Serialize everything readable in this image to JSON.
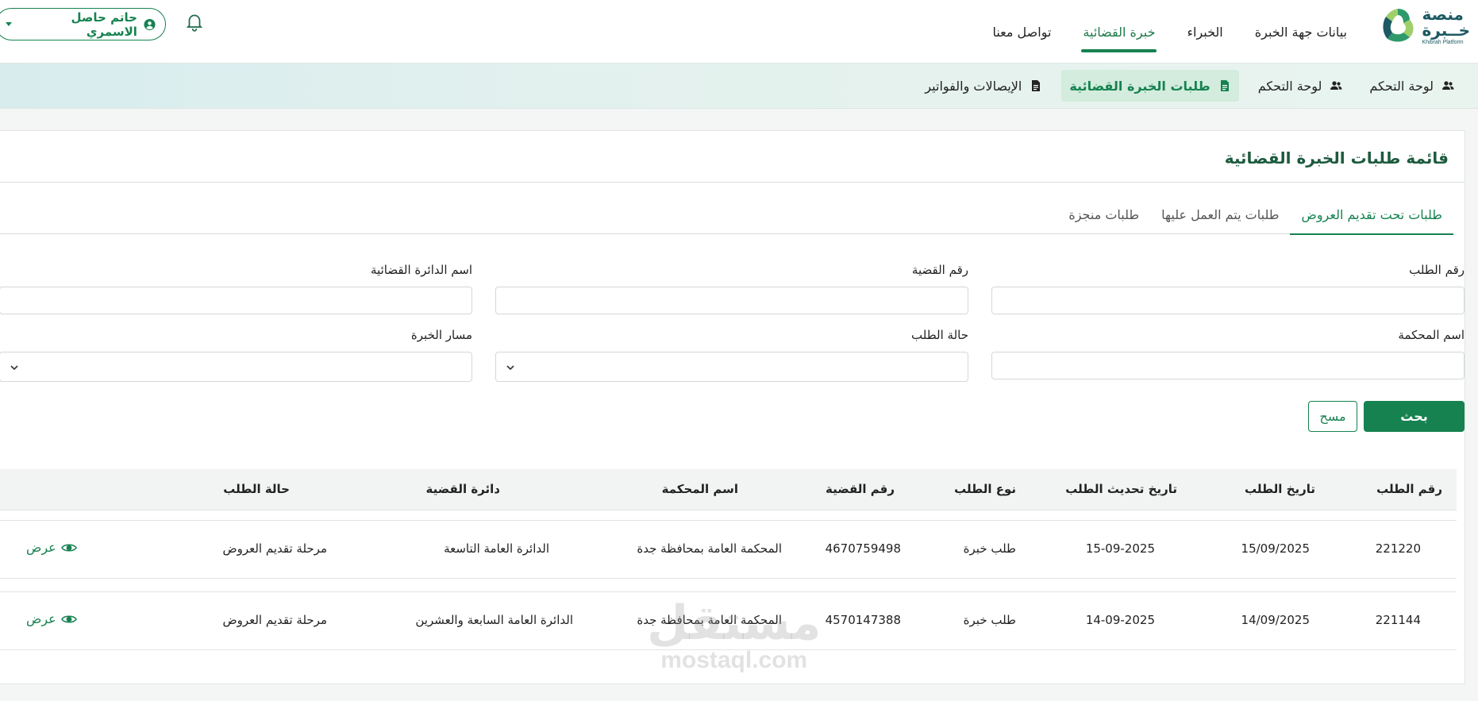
{
  "logo": {
    "line1": "منصة",
    "line2": "خــبرة",
    "en": "Khibrah Platform"
  },
  "topnav": [
    {
      "label": "بيانات جهة الخبرة",
      "active": false
    },
    {
      "label": "الخبراء",
      "active": false
    },
    {
      "label": "خبرة القضائية",
      "active": true
    },
    {
      "label": "تواصل معنا",
      "active": false
    }
  ],
  "user": {
    "name": "حاتم حاصل الاسمري"
  },
  "subnav": [
    {
      "label": "لوحة التحكم",
      "icon": "users-icon",
      "active": false
    },
    {
      "label": "لوحة التحكم",
      "icon": "users-icon",
      "active": false
    },
    {
      "label": "طلبات الخبرة القضائية",
      "icon": "document-icon",
      "active": true
    },
    {
      "label": "الإيصالات والفواتير",
      "icon": "document-icon",
      "active": false
    }
  ],
  "page_title": "قائمة طلبات الخبرة القضائية",
  "tabs": [
    {
      "label": "طلبات تحت تقديم العروض",
      "active": true
    },
    {
      "label": "طلبات يتم العمل عليها",
      "active": false
    },
    {
      "label": "طلبات منجزة",
      "active": false
    }
  ],
  "filters": {
    "request_number": {
      "label": "رقم الطلب",
      "value": ""
    },
    "case_number": {
      "label": "رقم القضية",
      "value": ""
    },
    "circuit_name": {
      "label": "اسم الدائرة القضائية",
      "value": ""
    },
    "court_name": {
      "label": "اسم المحكمة",
      "value": ""
    },
    "request_status": {
      "label": "حالة الطلب",
      "value": ""
    },
    "expertise_path": {
      "label": "مسار الخبرة",
      "value": ""
    }
  },
  "buttons": {
    "search": "بحث",
    "clear": "مسح"
  },
  "table": {
    "headers": [
      "رقم الطلب",
      "تاريخ الطلب",
      "تاريخ تحديث الطلب",
      "نوع الطلب",
      "رقم القضية",
      "اسم المحكمة",
      "دائرة القضية",
      "حالة الطلب"
    ],
    "rows": [
      [
        "221220",
        "15/09/2025",
        "15-09-2025",
        "طلب خبرة",
        "4670759498",
        "المحكمة العامة بمحافظة جدة",
        "الدائرة العامة التاسعة",
        "مرحلة تقديم العروض"
      ],
      [
        "221144",
        "14/09/2025",
        "14-09-2025",
        "طلب خبرة",
        "4570147388",
        "المحكمة العامة بمحافظة جدة",
        "الدائرة العامة السابعة والعشرين",
        "مرحلة تقديم العروض"
      ]
    ],
    "view_label": "عرض"
  },
  "watermark": {
    "ar": "مستقل",
    "en": "mostaql.com"
  },
  "colors": {
    "primary": "#168250",
    "title": "#1d5a3e"
  }
}
